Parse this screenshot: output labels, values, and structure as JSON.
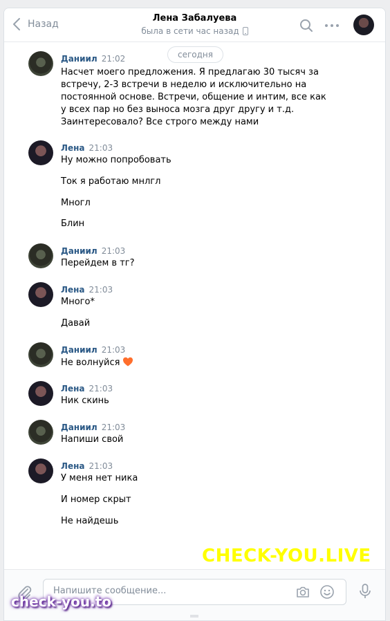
{
  "header": {
    "back_label": "Назад",
    "peer_name": "Лена Забалуева",
    "peer_status": "была в сети час назад"
  },
  "date_separator": "сегодня",
  "messages": [
    {
      "author": "Даниил",
      "time": "21:02",
      "lines": [
        "Насчет моего предложения. Я предлагаю 30 тысяч за встречу, 2-3 встречи в неделю и исключительно на постоянной основе. Встречи, общение и интим, все как у всех пар но без выноса мозга друг другу и т.д. Заинтересовало? Все строго между нами"
      ]
    },
    {
      "author": "Лена",
      "time": "21:03",
      "lines": [
        "Ну можно попробовать",
        "Ток я работаю мнлгл",
        "Многл",
        "Блин"
      ]
    },
    {
      "author": "Даниил",
      "time": "21:03",
      "lines": [
        "Перейдем в тг?"
      ]
    },
    {
      "author": "Лена",
      "time": "21:03",
      "lines": [
        "Много*",
        "Давай"
      ]
    },
    {
      "author": "Даниил",
      "time": "21:03",
      "lines": [
        "Не волнуйся"
      ]
    },
    {
      "author": "Лена",
      "time": "21:03",
      "lines": [
        "Ник скинь"
      ]
    },
    {
      "author": "Даниил",
      "time": "21:03",
      "lines": [
        "Напиши свой"
      ]
    },
    {
      "author": "Лена",
      "time": "21:03",
      "lines": [
        "У меня нет ника",
        "И номер скрыт",
        "Не найдешь"
      ]
    }
  ],
  "composer": {
    "placeholder": "Напишите сообщение..."
  },
  "watermarks": {
    "top": "CHECK-YOU.LIVE",
    "bottom": "check-you.to"
  },
  "colors": {
    "author": "#2a5885",
    "muted": "#818c99",
    "heart": "#ff6e2c",
    "watermark_yellow": "#ffff00"
  }
}
